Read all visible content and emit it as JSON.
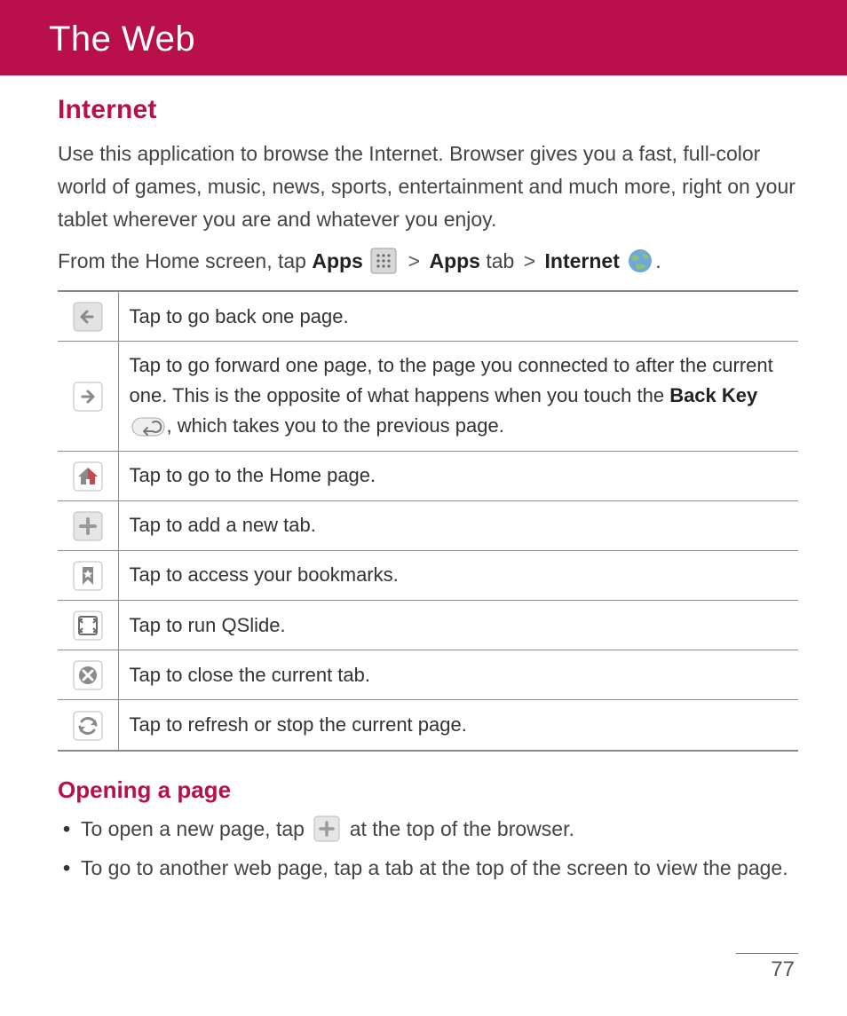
{
  "header": {
    "title": "The Web"
  },
  "internet": {
    "heading": "Internet",
    "intro": "Use this application to browse the Internet. Browser gives you a fast, full-color world of games, music, news, sports, entertainment and much more, right on your tablet wherever you are and whatever you enjoy.",
    "navline": {
      "prefix": "From the Home screen, tap ",
      "apps1": "Apps",
      "sep1": ">",
      "apps2": "Apps",
      "tab": " tab ",
      "sep2": ">",
      "internet": "Internet",
      "period": "."
    }
  },
  "table": {
    "rows": [
      {
        "icon": "back-arrow-icon",
        "desc_plain": "Tap to go back one page."
      },
      {
        "icon": "forward-arrow-icon",
        "desc_pre": "Tap to go forward one page, to the page you connected to after the current one. This is the opposite of what happens when you touch the ",
        "bold": "Back Key",
        "desc_post": ", which takes you to the previous page."
      },
      {
        "icon": "home-icon",
        "desc_plain": "Tap to go to the Home page."
      },
      {
        "icon": "plus-icon",
        "desc_plain": "Tap to add a new tab."
      },
      {
        "icon": "bookmark-icon",
        "desc_plain": "Tap to access your bookmarks."
      },
      {
        "icon": "qslide-icon",
        "desc_plain": "Tap to run QSlide."
      },
      {
        "icon": "close-x-icon",
        "desc_plain": "Tap to close the current tab."
      },
      {
        "icon": "refresh-icon",
        "desc_plain": "Tap to refresh or stop the current page."
      }
    ]
  },
  "opening": {
    "heading": "Opening a page",
    "items": [
      {
        "pre": "To open a new page, tap ",
        "post": " at the top of the browser."
      },
      {
        "full": "To go to another web page, tap a tab at the top of the screen to view the page."
      }
    ]
  },
  "page_number": "77"
}
